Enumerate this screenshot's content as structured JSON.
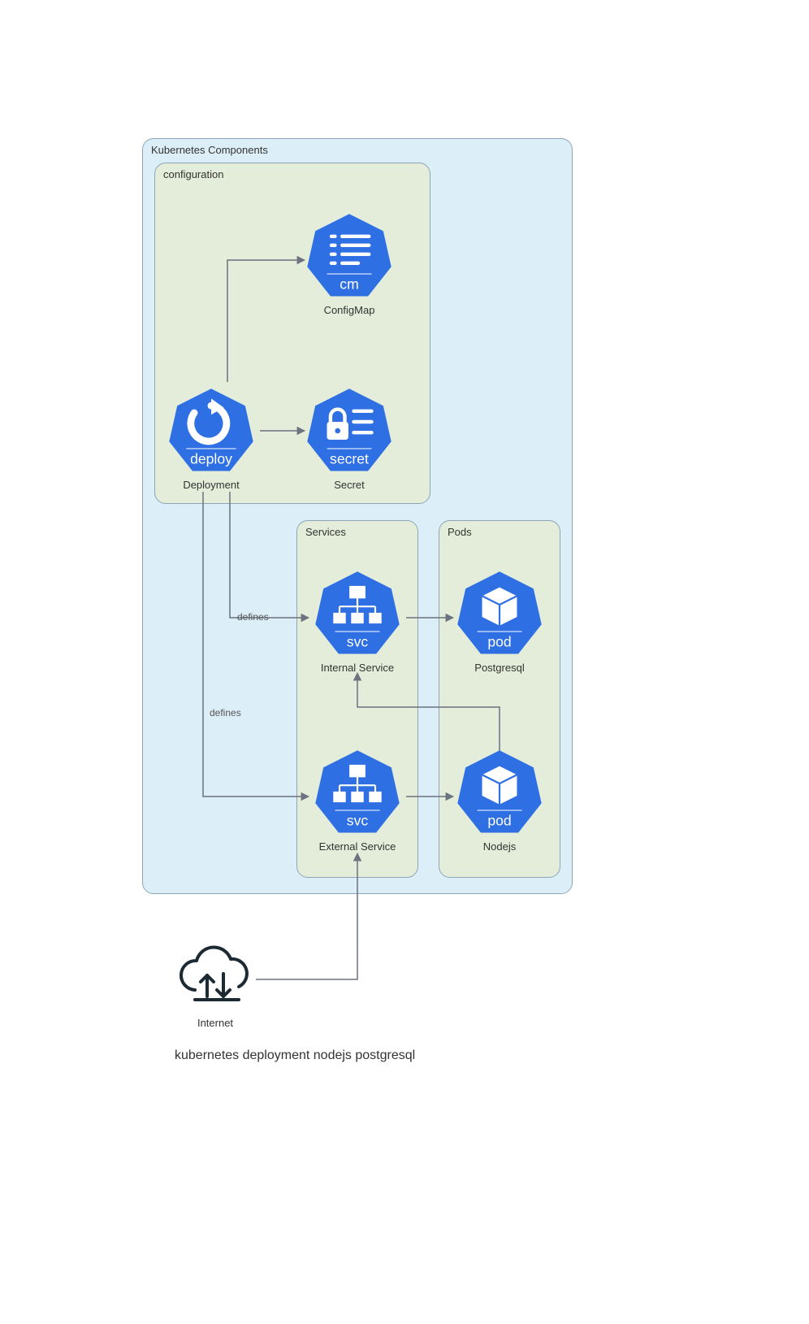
{
  "panels": {
    "outer": "Kubernetes Components",
    "configuration": "configuration",
    "services": "Services",
    "pods": "Pods"
  },
  "nodes": {
    "configmap": {
      "badge": "cm",
      "label": "ConfigMap"
    },
    "secret": {
      "badge": "secret",
      "label": "Secret"
    },
    "deployment": {
      "badge": "deploy",
      "label": "Deployment"
    },
    "svc_internal": {
      "badge": "svc",
      "label": "Internal Service"
    },
    "svc_external": {
      "badge": "svc",
      "label": "External Service"
    },
    "pod_pg": {
      "badge": "pod",
      "label": "Postgresql"
    },
    "pod_node": {
      "badge": "pod",
      "label": "Nodejs"
    }
  },
  "edges": {
    "defines1": "defines",
    "defines2": "defines"
  },
  "internet": {
    "label": "Internet"
  },
  "footer": "kubernetes deployment nodejs postgresql"
}
